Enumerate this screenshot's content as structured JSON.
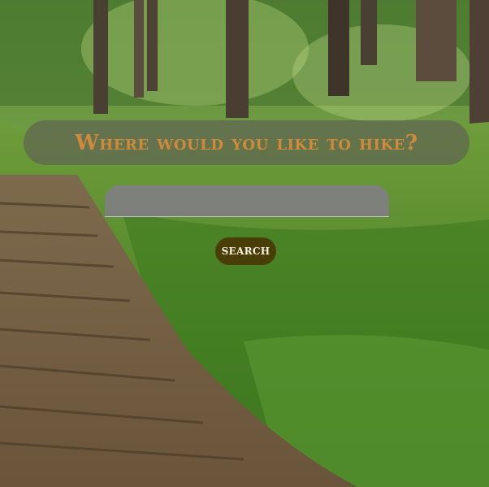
{
  "hero": {
    "heading": "Where would you like to hike?"
  },
  "search": {
    "value": "",
    "placeholder": "",
    "button_label": "SEARCH"
  },
  "colors": {
    "heading_text": "#cf8a3b",
    "heading_bar": "#5f6452",
    "input_background": "#807e82",
    "button_background": "#4a3e08",
    "button_text": "#f3efe0"
  }
}
